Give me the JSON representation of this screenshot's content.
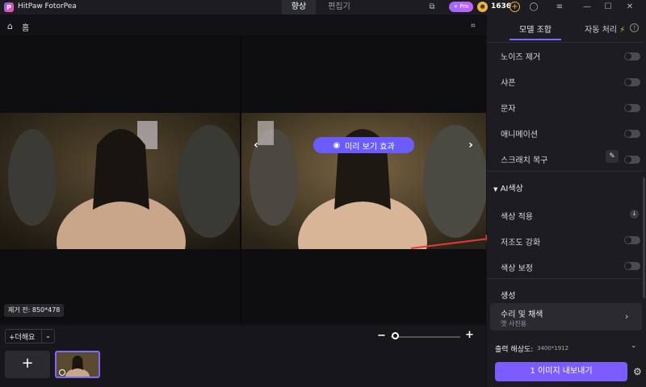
{
  "app": {
    "title": "HitPaw FotorPea",
    "logo_letter": "P"
  },
  "mode_tabs": [
    {
      "label": "향상",
      "active": true
    },
    {
      "label": "편집기",
      "active": false
    }
  ],
  "titlebar": {
    "pro_label": "+ Pro",
    "coin_count": "1636"
  },
  "toolbar": {
    "home_label": "홈"
  },
  "canvas": {
    "preview_label": "미리 보기 효과",
    "size_label": "제거 전: 850*478"
  },
  "bottom": {
    "add_more_label": "+더해요"
  },
  "side": {
    "tabs": [
      {
        "label": "모델 조합",
        "active": true
      },
      {
        "label": "자동 처리",
        "active": false
      }
    ],
    "rows_top": [
      {
        "label": "노이즈 제거"
      },
      {
        "label": "샤픈"
      },
      {
        "label": "문자"
      },
      {
        "label": "애니메이션"
      },
      {
        "label": "스크래치 복구"
      }
    ],
    "ai_section_label": "AI색상",
    "rows_ai": [
      {
        "label": "색상 적용"
      },
      {
        "label": "저조도 강화"
      },
      {
        "label": "색상 보정"
      }
    ],
    "gen_label": "생성",
    "repair_title": "수리 및 채색",
    "repair_sub": "옛 사진용",
    "resolution_label": "출력 해상도:",
    "resolution_value": "3400*1912",
    "export_label": "1 이미지 내보내기"
  },
  "colors": {
    "accent": "#7a5cff",
    "annotation_arrow": "#e23b3b"
  }
}
